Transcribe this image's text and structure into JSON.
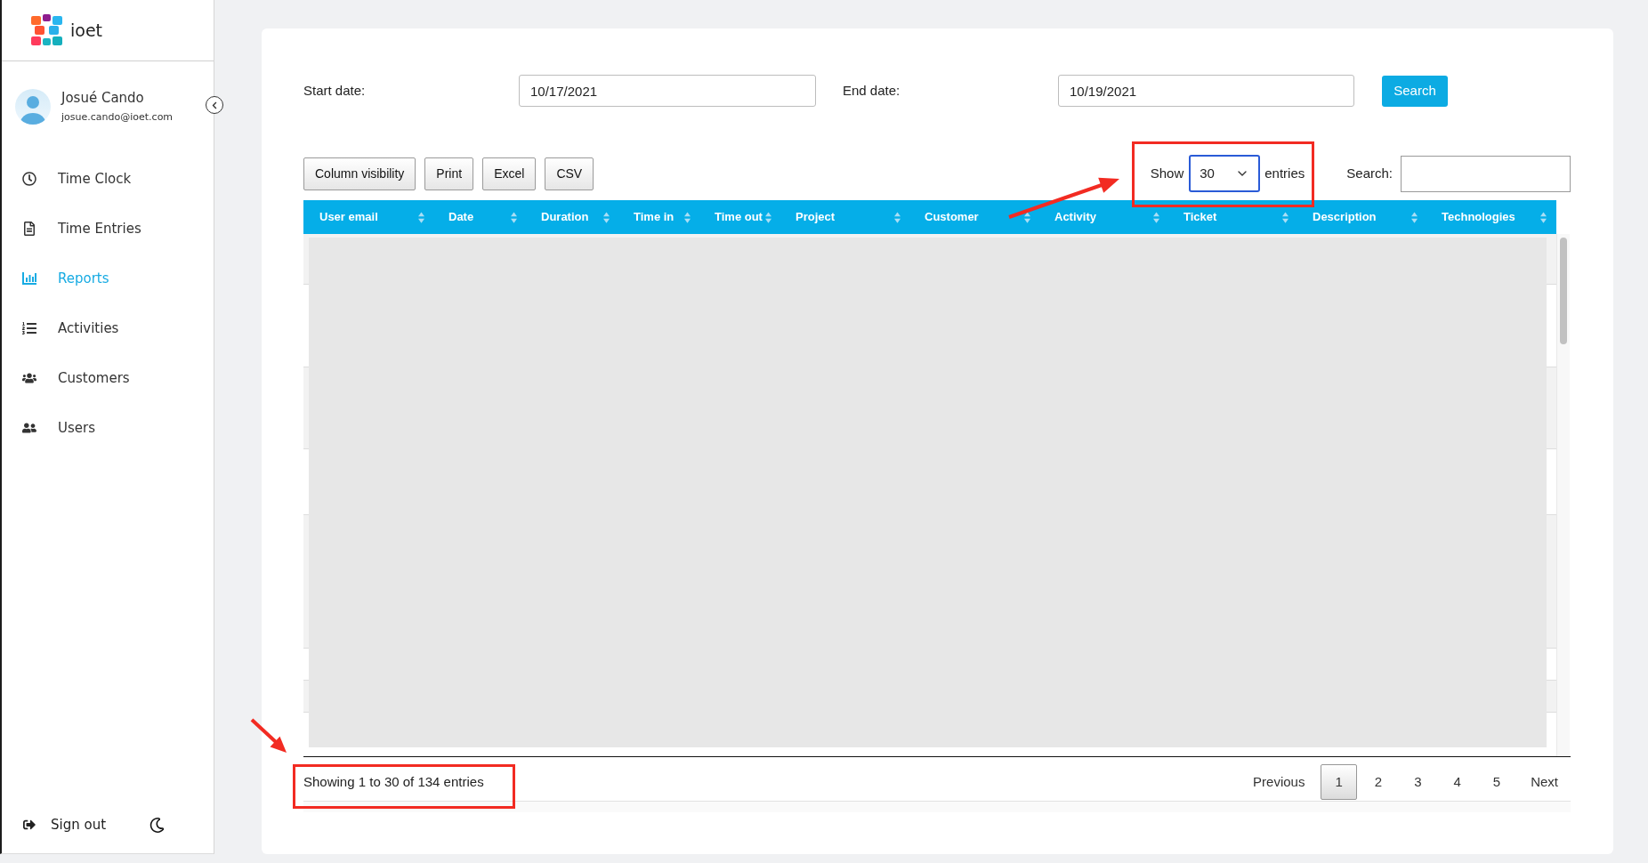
{
  "sidebar": {
    "logo": "ioet",
    "user": {
      "name": "Josué Cando",
      "email": "josue.cando@ioet.com"
    },
    "nav": [
      {
        "label": "Time Clock",
        "selected": false
      },
      {
        "label": "Time Entries",
        "selected": false
      },
      {
        "label": "Reports",
        "selected": true
      },
      {
        "label": "Activities",
        "selected": false
      },
      {
        "label": "Customers",
        "selected": false
      },
      {
        "label": "Users",
        "selected": false
      }
    ],
    "sign_out": "Sign out"
  },
  "filters": {
    "start_date": {
      "label": "Start date:",
      "value": "10/17/2021"
    },
    "end_date": {
      "label": "End date:",
      "value": "10/19/2021"
    },
    "search_button": "Search"
  },
  "toolbar": {
    "buttons": [
      "Column visibility",
      "Print",
      "Excel",
      "CSV"
    ],
    "page_length": {
      "label_before": "Show",
      "value": "30",
      "label_after": "entries"
    },
    "search": {
      "label": "Search:"
    }
  },
  "table": {
    "columns": [
      "User email",
      "Date",
      "Duration",
      "Time in",
      "Time out",
      "Project",
      "Customer",
      "Activity",
      "Ticket",
      "Description",
      "Technologies"
    ]
  },
  "footer": {
    "info": "Showing 1 to 30 of 134 entries",
    "previous": "Previous",
    "pages": [
      {
        "label": "1",
        "selected": true
      },
      {
        "label": "2",
        "selected": false
      },
      {
        "label": "3",
        "selected": false
      },
      {
        "label": "4",
        "selected": false
      },
      {
        "label": "5",
        "selected": false
      }
    ],
    "next": "Next"
  }
}
